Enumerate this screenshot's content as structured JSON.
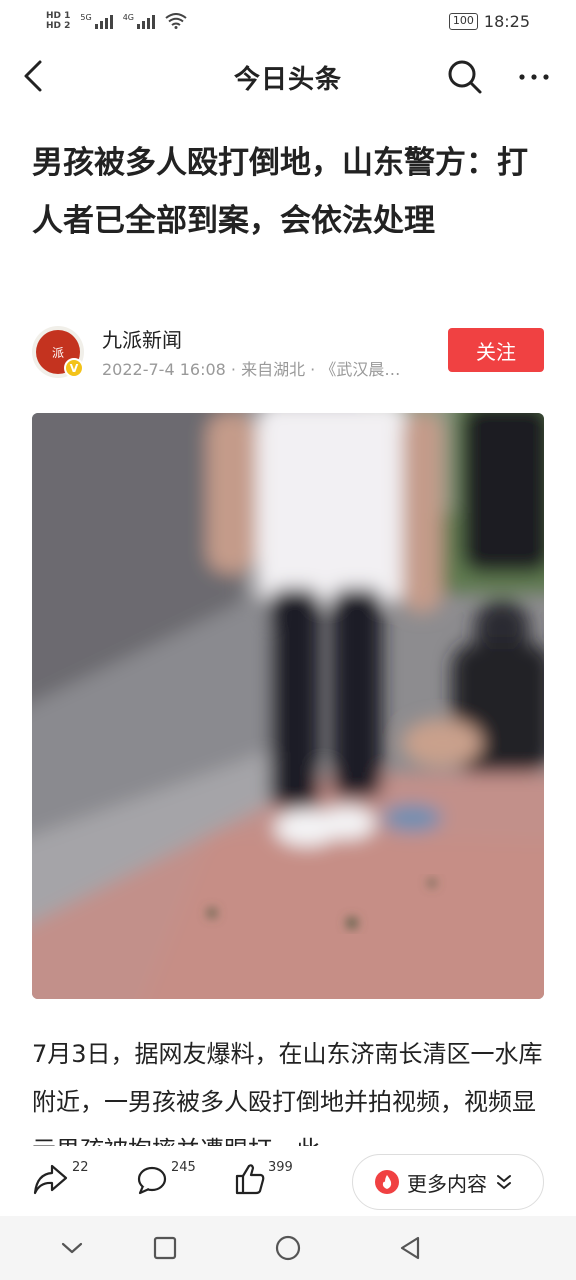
{
  "status_bar": {
    "hd1": "HD",
    "hd2": "HD",
    "sim1": "1",
    "sim2": "2",
    "net1": "5G",
    "net2": "4G",
    "battery": "100",
    "time": "18:25"
  },
  "nav": {
    "title": "今日头条",
    "back_icon": "back-arrow-icon",
    "search_icon": "search-icon",
    "more_icon": "more-dots-icon"
  },
  "article": {
    "headline": "男孩被多人殴打倒地，山东警方：打人者已全部到案，会依法处理",
    "author": {
      "name": "九派新闻",
      "avatar_text": "派",
      "verified_badge": "V",
      "meta": "2022-7-4 16:08 · 来自湖北 · 《武汉晨…",
      "follow_label": "关注"
    },
    "body": "7月3日，据网友爆料，在山东济南长清区一水库附近，一男孩被多人殴打倒地并拍视频，视频显示男孩被抱摔并遭踢打，此"
  },
  "actions": {
    "share_count": "22",
    "comment_count": "245",
    "like_count": "399",
    "more_content_label": "更多内容"
  },
  "colors": {
    "accent_red": "#f04142",
    "text_primary": "#222222",
    "text_secondary": "#999999"
  }
}
